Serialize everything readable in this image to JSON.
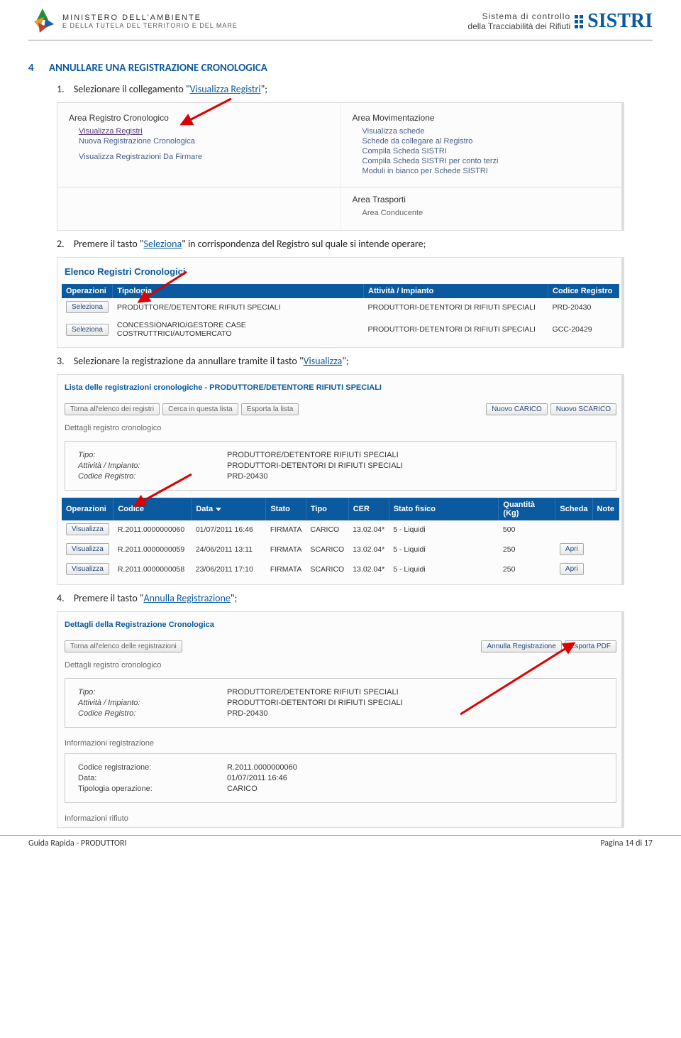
{
  "header": {
    "ministry_line1": "MINISTERO DELL'AMBIENTE",
    "ministry_line2": "E DELLA TUTELA DEL TERRITORIO E DEL MARE",
    "sistri_desc1": "Sistema di controllo",
    "sistri_desc2": "della Tracciabilità dei Rifiuti",
    "sistri_logo": "SISTRI"
  },
  "section": {
    "number": "4",
    "title": "ANNULLARE UNA REGISTRAZIONE CRONOLOGICA"
  },
  "steps": {
    "s1num": "1.",
    "s1a": "Selezionare il collegamento \"",
    "s1link": "Visualizza Registri",
    "s1b": "\";",
    "s2num": "2.",
    "s2a": "Premere il tasto \"",
    "s2link": "Seleziona",
    "s2b": "\" in corrispondenza del Registro sul quale si intende operare;",
    "s3num": "3.",
    "s3a": "Selezionare la registrazione da annullare tramite il tasto \"",
    "s3link": "Visualizza",
    "s3b": "\";",
    "s4num": "4.",
    "s4a": "Premere il tasto \"",
    "s4link": "Annulla Registrazione",
    "s4b": "\";"
  },
  "panel1": {
    "area1_title": "Area Registro Cronologico",
    "area1_links": [
      "Visualizza Registri",
      "Nuova Registrazione Cronologica",
      "Visualizza Registrazioni Da Firmare"
    ],
    "area2_title": "Area Movimentazione",
    "area2_links": [
      "Visualizza schede",
      "Schede da collegare al Registro",
      "Compila Scheda SISTRI",
      "Compila Scheda SISTRI per conto terzi",
      "Moduli in bianco per Schede SISTRI"
    ],
    "area3_title": "Area Trasporti",
    "area3_sub": "Area Conducente"
  },
  "panel2": {
    "title": "Elenco Registri Cronologici",
    "headers": [
      "Operazioni",
      "Tipologia",
      "Attività / Impianto",
      "Codice Registro"
    ],
    "rows": [
      {
        "btn": "Seleziona",
        "tip": "PRODUTTORE/DETENTORE RIFIUTI SPECIALI",
        "att": "PRODUTTORI-DETENTORI DI RIFIUTI SPECIALI",
        "cod": "PRD-20430"
      },
      {
        "btn": "Seleziona",
        "tip": "CONCESSIONARIO/GESTORE CASE COSTRUTTRICI/AUTOMERCATO",
        "att": "PRODUTTORI-DETENTORI DI RIFIUTI SPECIALI",
        "cod": "GCC-20429"
      }
    ]
  },
  "panel3": {
    "title": "Lista delle registrazioni cronologiche  - PRODUTTORE/DETENTORE RIFIUTI SPECIALI",
    "toolbar_left": [
      "Torna all'elenco dei registri",
      "Cerca in questa lista",
      "Esporta la lista"
    ],
    "toolbar_right": [
      "Nuovo CARICO",
      "Nuovo SCARICO"
    ],
    "subtitle": "Dettagli registro cronologico",
    "details": [
      {
        "lbl": "Tipo:",
        "val": "PRODUTTORE/DETENTORE RIFIUTI SPECIALI"
      },
      {
        "lbl": "Attività / Impianto:",
        "val": "PRODUTTORI-DETENTORI DI RIFIUTI SPECIALI"
      },
      {
        "lbl": "Codice Registro:",
        "val": "PRD-20430"
      }
    ],
    "headers": [
      "Operazioni",
      "Codice",
      "Data",
      "Stato",
      "Tipo",
      "CER",
      "Stato fisico",
      "Quantità (Kg)",
      "Scheda",
      "Note"
    ],
    "rows": [
      {
        "btn": "Visualizza",
        "cod": "R.2011.0000000060",
        "data": "01/07/2011 16:46",
        "stato": "FIRMATA",
        "tipo": "CARICO",
        "cer": "13.02.04*",
        "fis": "5 - Liquidi",
        "qty": "500",
        "scheda": "",
        "note": ""
      },
      {
        "btn": "Visualizza",
        "cod": "R.2011.0000000059",
        "data": "24/06/2011 13:11",
        "stato": "FIRMATA",
        "tipo": "SCARICO",
        "cer": "13.02.04*",
        "fis": "5 - Liquidi",
        "qty": "250",
        "scheda": "Apri",
        "note": ""
      },
      {
        "btn": "Visualizza",
        "cod": "R.2011.0000000058",
        "data": "23/06/2011 17:10",
        "stato": "FIRMATA",
        "tipo": "SCARICO",
        "cer": "13.02.04*",
        "fis": "5 - Liquidi",
        "qty": "250",
        "scheda": "Apri",
        "note": ""
      }
    ]
  },
  "panel4": {
    "title": "Dettagli della Registrazione Cronologica",
    "toolbar_left": "Torna all'elenco delle registrazioni",
    "toolbar_right": [
      "Annulla Registrazione",
      "Esporta PDF"
    ],
    "subtitle": "Dettagli registro cronologico",
    "details": [
      {
        "lbl": "Tipo:",
        "val": "PRODUTTORE/DETENTORE RIFIUTI SPECIALI"
      },
      {
        "lbl": "Attività / Impianto:",
        "val": "PRODUTTORI-DETENTORI DI RIFIUTI SPECIALI"
      },
      {
        "lbl": "Codice Registro:",
        "val": "PRD-20430"
      }
    ],
    "section2_label": "Informazioni registrazione",
    "details2": [
      {
        "lbl": "Codice registrazione:",
        "val": "R.2011.0000000060"
      },
      {
        "lbl": "Data:",
        "val": "01/07/2011 16:46"
      },
      {
        "lbl": "Tipologia operazione:",
        "val": "CARICO"
      }
    ],
    "section3_label": "Informazioni rifiuto"
  },
  "footer": {
    "left": "Guida Rapida - PRODUTTORI",
    "right": "Pagina 14 di 17"
  }
}
